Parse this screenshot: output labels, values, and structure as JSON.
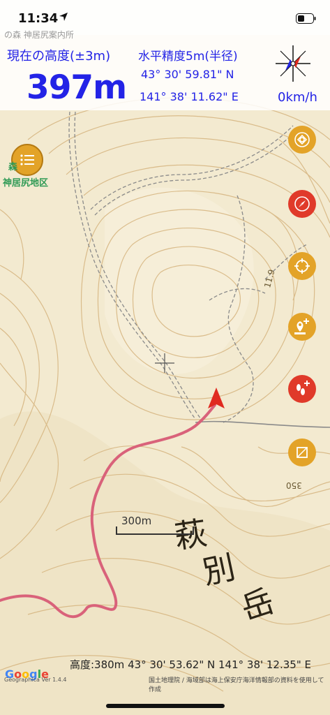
{
  "status_bar": {
    "time": "11:34"
  },
  "header": {
    "faint_place_text": "の森 神居尻案内所",
    "altitude_label": "現在の高度(±3m)",
    "altitude_value": "397m",
    "accuracy_label": "水平精度5m(半径)",
    "latitude": "43° 30' 59.81\" N",
    "longitude": "141° 38' 11.62\" E",
    "speed": "0km/h"
  },
  "map": {
    "place_label_line1": "森",
    "place_label_line2": "神居尻地区",
    "mountain_label": [
      "萩",
      "別",
      "岳"
    ],
    "contour_label_350": "350",
    "trail_number": "11.9",
    "scale_label": "300m",
    "track_color": "#d9627a",
    "contour_color": "#d7b783",
    "background_color": "#f3ead0",
    "bottom_readout": "高度:380m  43° 30' 53.62\" N 141° 38' 12.35\" E",
    "attribution": "国土地理院 / 海域部は海上保安庁海洋情報部の資料を使用して作成",
    "google_logo_text": "Google",
    "geographica_version": "Geographica Ver 1.4.4"
  },
  "right_buttons": [
    {
      "name": "layers-button",
      "icon": "spiral-icon",
      "color": "#e3a328"
    },
    {
      "name": "compass-mode-button",
      "icon": "compass-needle-icon",
      "color": "#e03a2a"
    },
    {
      "name": "locate-button",
      "icon": "crosshair-icon",
      "color": "#e3a328"
    },
    {
      "name": "add-marker-button",
      "icon": "pin-plus-icon",
      "color": "#e3a328"
    },
    {
      "name": "record-track-button",
      "icon": "footprints-plus-icon",
      "color": "#e03a2a"
    },
    {
      "name": "tool-button",
      "icon": "square-icon",
      "color": "#e3a328"
    }
  ]
}
